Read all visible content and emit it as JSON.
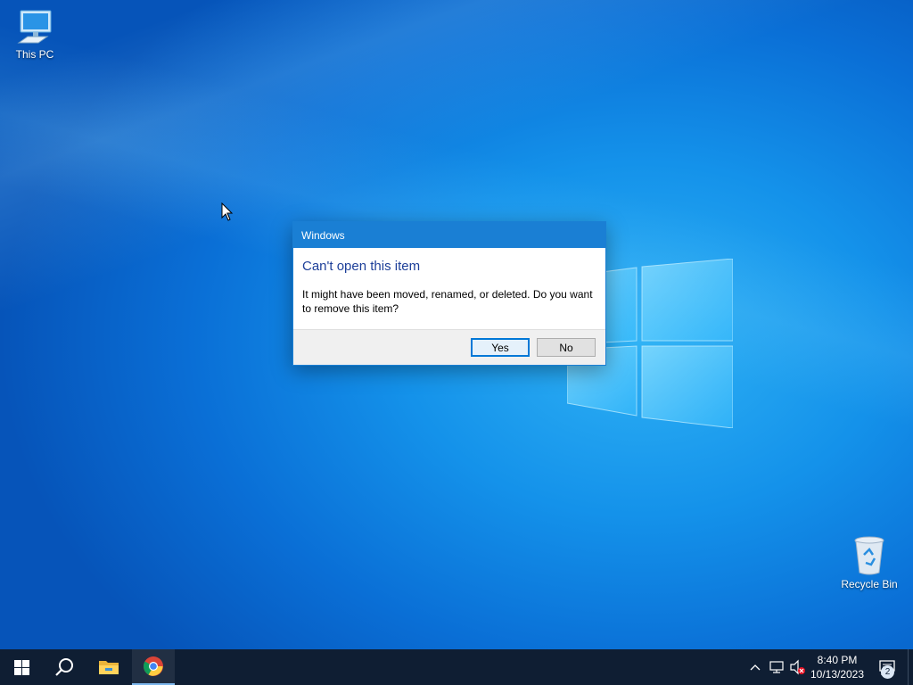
{
  "desktop": {
    "icons": [
      {
        "label": "This PC",
        "icon": "computer-icon"
      },
      {
        "label": "Recycle Bin",
        "icon": "recycle-bin-icon"
      }
    ]
  },
  "dialog": {
    "title": "Windows",
    "heading": "Can't open this item",
    "message": "It might have been moved, renamed, or deleted. Do you want to remove this item?",
    "yes_label": "Yes",
    "no_label": "No"
  },
  "taskbar": {
    "pinned": [
      {
        "name": "start",
        "icon": "windows-logo-icon"
      },
      {
        "name": "search",
        "icon": "search-icon"
      },
      {
        "name": "file-explorer",
        "icon": "folder-icon"
      },
      {
        "name": "chrome",
        "icon": "chrome-icon"
      }
    ],
    "tray": {
      "icons": [
        "chevron-up-icon",
        "network-icon",
        "volume-muted-icon"
      ],
      "time": "8:40 PM",
      "date": "10/13/2023",
      "notification_count": "2"
    }
  },
  "colors": {
    "accent": "#1a7fd4",
    "heading": "#1d3f99",
    "taskbar": "#0f1e33"
  }
}
